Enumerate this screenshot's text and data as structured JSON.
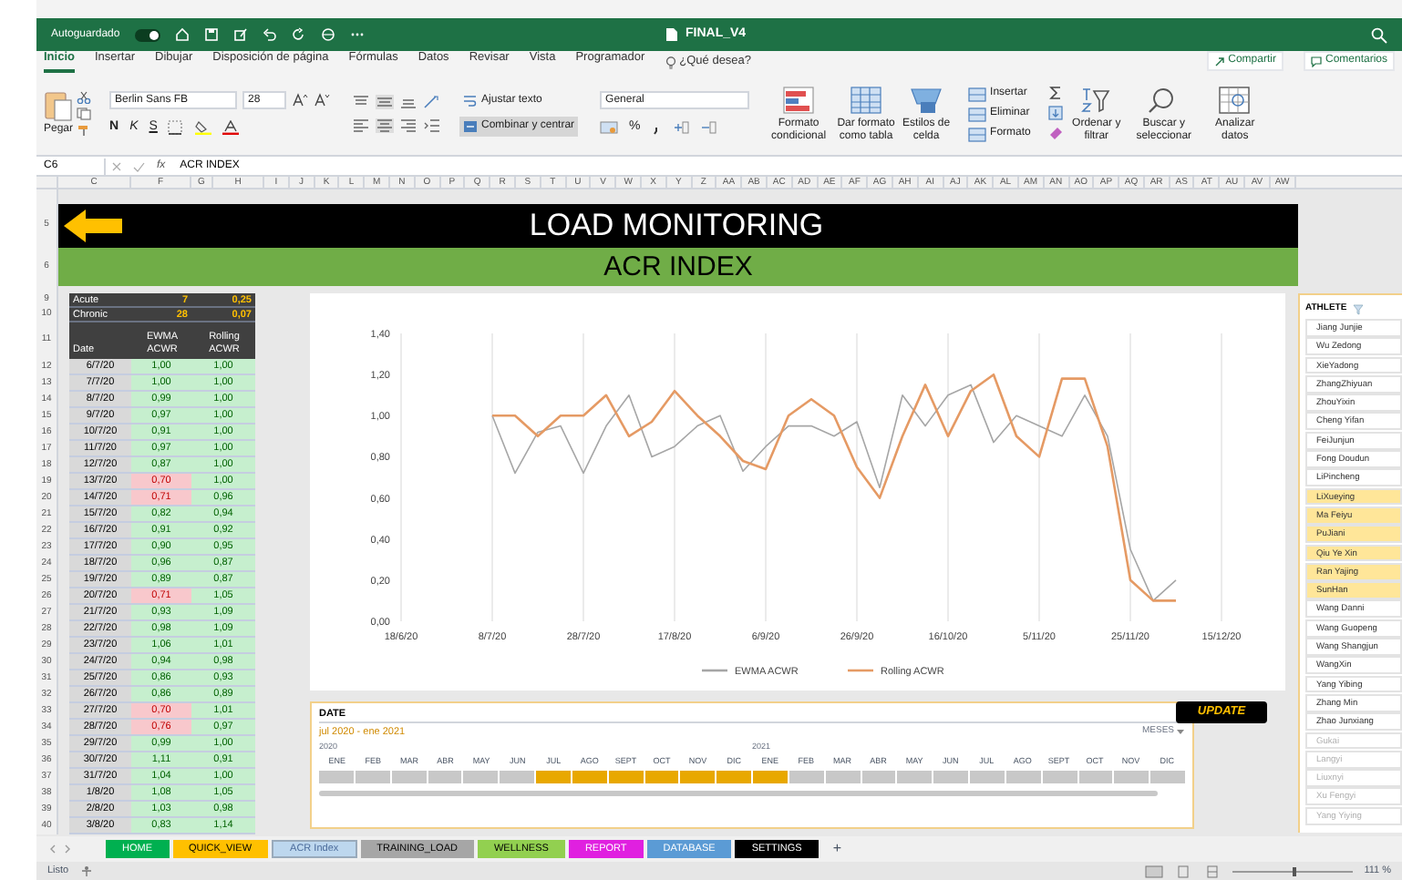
{
  "title_bar": {
    "autosave_label": "Autoguardado",
    "autosave_on": true,
    "document_title": "FINAL_V4"
  },
  "ribbon_tabs": [
    {
      "label": "Inicio",
      "selected": true
    },
    {
      "label": "Insertar",
      "selected": false
    },
    {
      "label": "Dibujar",
      "selected": false
    },
    {
      "label": "Disposición de página",
      "selected": false
    },
    {
      "label": "Fórmulas",
      "selected": false
    },
    {
      "label": "Datos",
      "selected": false
    },
    {
      "label": "Revisar",
      "selected": false
    },
    {
      "label": "Vista",
      "selected": false
    },
    {
      "label": "Programador",
      "selected": false
    }
  ],
  "tell_me": "¿Qué desea?",
  "share_button": "Compartir",
  "comments_button": "Comentarios",
  "ribbon": {
    "paste": "Pegar",
    "font_name": "Berlin Sans FB",
    "font_size": "28",
    "bold": "N",
    "italic": "K",
    "underline": "S",
    "wrap_text": "Ajustar texto",
    "merge_center": "Combinar y centrar",
    "number_format": "General",
    "percent": "%",
    "conditional_format": "Formato condicional",
    "format_as_table": "Dar formato como tabla",
    "cell_styles": "Estilos de celda",
    "insert": "Insertar",
    "delete": "Eliminar",
    "format": "Formato",
    "sort_filter": "Ordenar y filtrar",
    "find_select": "Buscar y seleccionar",
    "analyze": "Analizar datos"
  },
  "formula_bar": {
    "cell": "C6",
    "function_label": "fx",
    "content": "ACR INDEX"
  },
  "column_headers": [
    "C",
    "F",
    "G",
    "H",
    "I",
    "J",
    "K",
    "L",
    "M",
    "N",
    "O",
    "P",
    "Q",
    "R",
    "S",
    "T",
    "U",
    "V",
    "W",
    "X",
    "Y",
    "Z",
    "AA",
    "AB",
    "AC",
    "AD",
    "AE",
    "AF",
    "AG",
    "AH",
    "AI",
    "AJ",
    "AK",
    "AL",
    "AM",
    "AN",
    "AO",
    "AP",
    "AQ",
    "AR",
    "AS",
    "AT",
    "AU",
    "AV",
    "AW"
  ],
  "banner": {
    "title_row": "5",
    "title": "LOAD MONITORING",
    "subtitle_row": "6",
    "subtitle": "ACR INDEX"
  },
  "acwr_table": {
    "summary": [
      {
        "row": "9",
        "label": "Acute",
        "days": "7",
        "value": "0,25"
      },
      {
        "row": "10",
        "label": "Chronic",
        "days": "28",
        "value": "0,07"
      }
    ],
    "header_row": "11",
    "columns": [
      "Date",
      "EWMA ACWR",
      "Rolling ACWR"
    ],
    "rows": [
      {
        "row": "12",
        "date": "6/7/20",
        "ewma": "1,00",
        "rolling": "1,00",
        "flagged": false
      },
      {
        "row": "13",
        "date": "7/7/20",
        "ewma": "1,00",
        "rolling": "1,00",
        "flagged": false
      },
      {
        "row": "14",
        "date": "8/7/20",
        "ewma": "0,99",
        "rolling": "1,00",
        "flagged": false
      },
      {
        "row": "15",
        "date": "9/7/20",
        "ewma": "0,97",
        "rolling": "1,00",
        "flagged": false
      },
      {
        "row": "16",
        "date": "10/7/20",
        "ewma": "0,91",
        "rolling": "1,00",
        "flagged": false
      },
      {
        "row": "17",
        "date": "11/7/20",
        "ewma": "0,97",
        "rolling": "1,00",
        "flagged": false
      },
      {
        "row": "18",
        "date": "12/7/20",
        "ewma": "0,87",
        "rolling": "1,00",
        "flagged": false
      },
      {
        "row": "19",
        "date": "13/7/20",
        "ewma": "0,70",
        "rolling": "1,00",
        "flagged": true
      },
      {
        "row": "20",
        "date": "14/7/20",
        "ewma": "0,71",
        "rolling": "0,96",
        "flagged": true
      },
      {
        "row": "21",
        "date": "15/7/20",
        "ewma": "0,82",
        "rolling": "0,94",
        "flagged": false
      },
      {
        "row": "22",
        "date": "16/7/20",
        "ewma": "0,91",
        "rolling": "0,92",
        "flagged": false
      },
      {
        "row": "23",
        "date": "17/7/20",
        "ewma": "0,90",
        "rolling": "0,95",
        "flagged": false
      },
      {
        "row": "24",
        "date": "18/7/20",
        "ewma": "0,96",
        "rolling": "0,87",
        "flagged": false
      },
      {
        "row": "25",
        "date": "19/7/20",
        "ewma": "0,89",
        "rolling": "0,87",
        "flagged": false
      },
      {
        "row": "26",
        "date": "20/7/20",
        "ewma": "0,71",
        "rolling": "1,05",
        "flagged": true
      },
      {
        "row": "27",
        "date": "21/7/20",
        "ewma": "0,93",
        "rolling": "1,09",
        "flagged": false
      },
      {
        "row": "28",
        "date": "22/7/20",
        "ewma": "0,98",
        "rolling": "1,09",
        "flagged": false
      },
      {
        "row": "29",
        "date": "23/7/20",
        "ewma": "1,06",
        "rolling": "1,01",
        "flagged": false
      },
      {
        "row": "30",
        "date": "24/7/20",
        "ewma": "0,94",
        "rolling": "0,98",
        "flagged": false
      },
      {
        "row": "31",
        "date": "25/7/20",
        "ewma": "0,86",
        "rolling": "0,93",
        "flagged": false
      },
      {
        "row": "32",
        "date": "26/7/20",
        "ewma": "0,86",
        "rolling": "0,89",
        "flagged": false
      },
      {
        "row": "33",
        "date": "27/7/20",
        "ewma": "0,70",
        "rolling": "1,01",
        "flagged": true
      },
      {
        "row": "34",
        "date": "28/7/20",
        "ewma": "0,76",
        "rolling": "0,97",
        "flagged": true
      },
      {
        "row": "35",
        "date": "29/7/20",
        "ewma": "0,99",
        "rolling": "1,00",
        "flagged": false
      },
      {
        "row": "36",
        "date": "30/7/20",
        "ewma": "1,11",
        "rolling": "0,91",
        "flagged": false
      },
      {
        "row": "37",
        "date": "31/7/20",
        "ewma": "1,04",
        "rolling": "1,00",
        "flagged": false
      },
      {
        "row": "38",
        "date": "1/8/20",
        "ewma": "1,08",
        "rolling": "1,05",
        "flagged": false
      },
      {
        "row": "39",
        "date": "2/8/20",
        "ewma": "1,03",
        "rolling": "0,98",
        "flagged": false
      },
      {
        "row": "40",
        "date": "3/8/20",
        "ewma": "0,83",
        "rolling": "1,14",
        "flagged": false
      }
    ]
  },
  "chart": {
    "chart_data": {
      "type": "line",
      "categories": [
        "18/6/20",
        null,
        null,
        null,
        "8/7/20",
        null,
        null,
        null,
        "28/7/20",
        null,
        null,
        null,
        "17/8/20",
        null,
        null,
        null,
        "6/9/20",
        null,
        null,
        null,
        "26/9/20",
        null,
        null,
        null,
        "16/10/20",
        null,
        null,
        null,
        "5/11/20",
        null,
        null,
        null,
        "25/11/20",
        null,
        null,
        null,
        "15/12/20"
      ],
      "series": [
        {
          "name": "EWMA ACWR",
          "color": "#a6a6a6",
          "values": [
            null,
            null,
            null,
            null,
            1.0,
            0.72,
            0.92,
            0.95,
            0.72,
            0.95,
            1.1,
            0.8,
            0.85,
            0.95,
            1.0,
            0.73,
            0.85,
            0.95,
            0.95,
            0.9,
            0.97,
            0.65,
            1.1,
            0.95,
            1.1,
            1.15,
            0.87,
            1.0,
            0.95,
            0.9,
            1.1,
            0.9,
            0.35,
            0.1,
            0.2,
            null,
            null
          ]
        },
        {
          "name": "Rolling ACWR",
          "color": "#e59a64",
          "values": [
            null,
            null,
            null,
            null,
            1.0,
            1.0,
            0.9,
            1.0,
            1.0,
            1.1,
            0.9,
            0.97,
            1.12,
            1.0,
            0.9,
            0.78,
            0.74,
            1.0,
            1.08,
            1.0,
            0.75,
            0.6,
            0.9,
            1.15,
            0.9,
            1.12,
            1.2,
            0.9,
            0.8,
            1.18,
            1.18,
            0.85,
            0.2,
            0.1,
            0.1,
            null,
            null
          ]
        }
      ],
      "ylim": [
        0,
        1.4
      ],
      "grid": true,
      "legend": "bottom",
      "yticks": [
        {
          "value": 0,
          "label": "0,00"
        },
        {
          "value": 0.2,
          "label": "0,20"
        },
        {
          "value": 0.4,
          "label": "0,40"
        },
        {
          "value": 0.6,
          "label": "0,60"
        },
        {
          "value": 0.8,
          "label": "0,80"
        },
        {
          "value": 1.0,
          "label": "1,00"
        },
        {
          "value": 1.2,
          "label": "1,20"
        },
        {
          "value": 1.4,
          "label": "1,40"
        }
      ]
    }
  },
  "date_slicer": {
    "title": "DATE",
    "range": "jul 2020 - ene 2021",
    "period": "MESES",
    "years": [
      "2020",
      "2021"
    ],
    "months": [
      {
        "label": "ENE",
        "selected": false
      },
      {
        "label": "FEB",
        "selected": false
      },
      {
        "label": "MAR",
        "selected": false
      },
      {
        "label": "ABR",
        "selected": false
      },
      {
        "label": "MAY",
        "selected": false
      },
      {
        "label": "JUN",
        "selected": false
      },
      {
        "label": "JUL",
        "selected": true
      },
      {
        "label": "AGO",
        "selected": true
      },
      {
        "label": "SEPT",
        "selected": true
      },
      {
        "label": "OCT",
        "selected": true
      },
      {
        "label": "NOV",
        "selected": true
      },
      {
        "label": "DIC",
        "selected": true
      },
      {
        "label": "ENE",
        "selected": true
      },
      {
        "label": "FEB",
        "selected": false
      },
      {
        "label": "MAR",
        "selected": false
      },
      {
        "label": "ABR",
        "selected": false
      },
      {
        "label": "MAY",
        "selected": false
      },
      {
        "label": "JUN",
        "selected": false
      },
      {
        "label": "JUL",
        "selected": false
      },
      {
        "label": "AGO",
        "selected": false
      },
      {
        "label": "SEPT",
        "selected": false
      },
      {
        "label": "OCT",
        "selected": false
      },
      {
        "label": "NOV",
        "selected": false
      },
      {
        "label": "DIC",
        "selected": false
      }
    ]
  },
  "update_button": "UPDATE",
  "athlete_slicer": {
    "title": "ATHLETE",
    "items": [
      {
        "name": "Jiang Junjie",
        "selected": false,
        "disabled": false
      },
      {
        "name": "Wu Zedong",
        "selected": false,
        "disabled": false
      },
      {
        "name": "XieYadong",
        "selected": false,
        "disabled": false
      },
      {
        "name": "ZhangZhiyuan",
        "selected": false,
        "disabled": false
      },
      {
        "name": "ZhouYixin",
        "selected": false,
        "disabled": false
      },
      {
        "name": "Cheng Yifan",
        "selected": false,
        "disabled": false
      },
      {
        "name": "FeiJunjun",
        "selected": false,
        "disabled": false
      },
      {
        "name": "Fong Doudun",
        "selected": false,
        "disabled": false
      },
      {
        "name": "LiPincheng",
        "selected": false,
        "disabled": false
      },
      {
        "name": "LiXueying",
        "selected": true,
        "disabled": false
      },
      {
        "name": "Ma Feiyu",
        "selected": true,
        "disabled": false
      },
      {
        "name": "PuJiani",
        "selected": true,
        "disabled": false
      },
      {
        "name": "Qiu Ye Xin",
        "selected": true,
        "disabled": false
      },
      {
        "name": "Ran Yajing",
        "selected": true,
        "disabled": false
      },
      {
        "name": "SunHan",
        "selected": true,
        "disabled": false
      },
      {
        "name": "Wang Danni",
        "selected": false,
        "disabled": false
      },
      {
        "name": "Wang Guopeng",
        "selected": false,
        "disabled": false
      },
      {
        "name": "Wang Shangjun",
        "selected": false,
        "disabled": false
      },
      {
        "name": "WangXin",
        "selected": false,
        "disabled": false
      },
      {
        "name": "Yang Yibing",
        "selected": false,
        "disabled": false
      },
      {
        "name": "Zhang Min",
        "selected": false,
        "disabled": false
      },
      {
        "name": "Zhao Junxiang",
        "selected": false,
        "disabled": false
      },
      {
        "name": "Gukai",
        "selected": false,
        "disabled": true
      },
      {
        "name": "Langyi",
        "selected": false,
        "disabled": true
      },
      {
        "name": "Liuxnyi",
        "selected": false,
        "disabled": true
      },
      {
        "name": "Xu Fengyi",
        "selected": false,
        "disabled": true
      },
      {
        "name": "Yang Yiying",
        "selected": false,
        "disabled": true
      }
    ]
  },
  "sheet_tabs": [
    {
      "label": "HOME",
      "color": "#00b050",
      "selected": false
    },
    {
      "label": "QUICK_VIEW",
      "color": "#ffc000",
      "selected": false
    },
    {
      "label": "ACR Index",
      "color": "#bdd7ee",
      "selected": true
    },
    {
      "label": "TRAINING_LOAD",
      "color": "#a6a6a6",
      "selected": false
    },
    {
      "label": "WELLNESS",
      "color": "#92d050",
      "selected": false
    },
    {
      "label": "REPORT",
      "color": "#e020e0",
      "selected": false
    },
    {
      "label": "DATABASE",
      "color": "#5b9bd5",
      "selected": false
    },
    {
      "label": "SETTINGS",
      "color": "#000000",
      "selected": false
    }
  ],
  "add_sheet": "+",
  "status_bar": {
    "status": "Listo",
    "zoom_slider": {
      "level": 0.52
    },
    "zoom": "111 %"
  }
}
